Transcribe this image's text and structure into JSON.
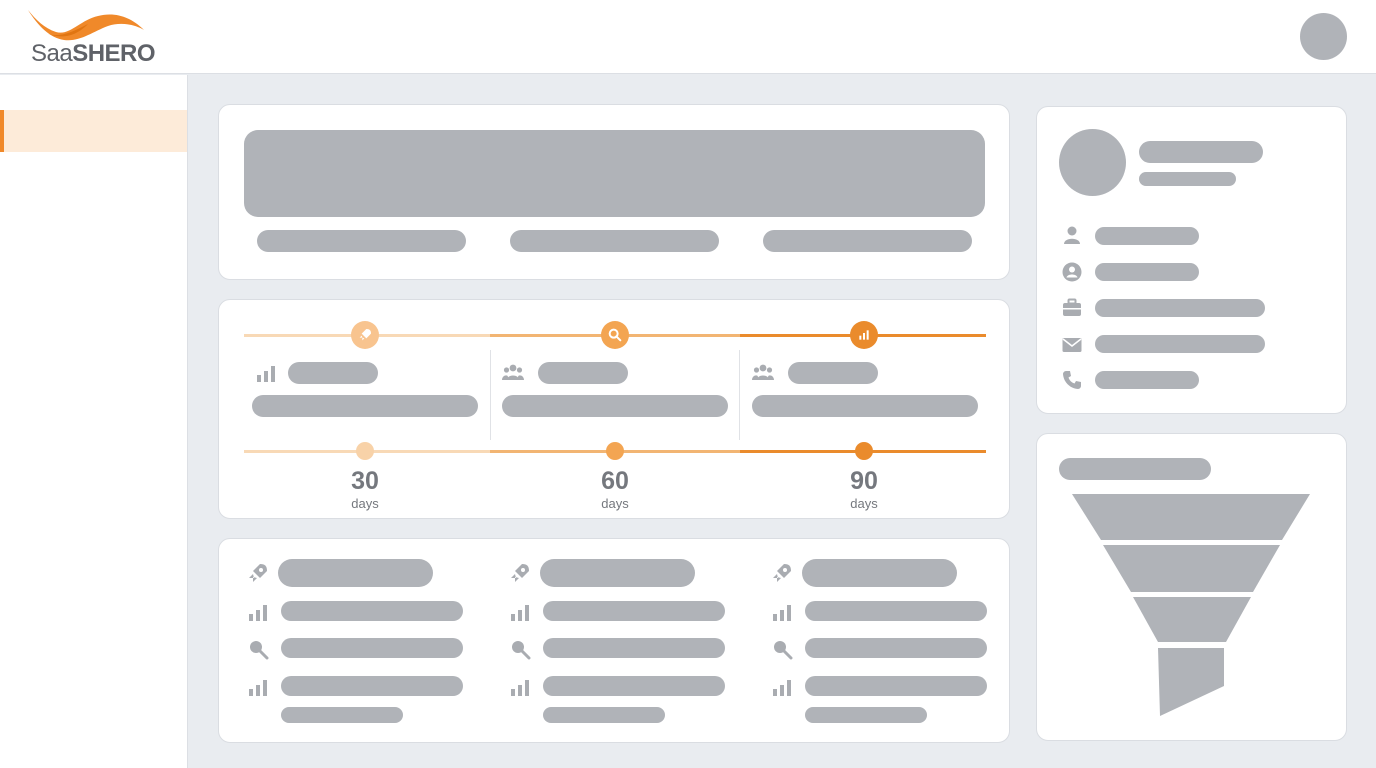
{
  "app": {
    "logo_text_light": "Saa",
    "logo_text_bold": "SHERO",
    "accent_color": "#f0892a",
    "accent_light": "#f8c48f",
    "accent_mid": "#f3a552"
  },
  "timeline": {
    "milestones": [
      {
        "number": "30",
        "unit": "days",
        "stage_icon": "rocket-icon",
        "metric_icon": "bar-chart-icon"
      },
      {
        "number": "60",
        "unit": "days",
        "stage_icon": "search-icon",
        "metric_icon": "users-icon"
      },
      {
        "number": "90",
        "unit": "days",
        "stage_icon": "bar-chart-icon",
        "metric_icon": "users-icon"
      }
    ]
  },
  "profile": {
    "field_icons": [
      "user-icon",
      "user-circle-icon",
      "briefcase-icon",
      "mail-icon",
      "phone-icon"
    ]
  },
  "funnel": {
    "stage_count": 4
  }
}
